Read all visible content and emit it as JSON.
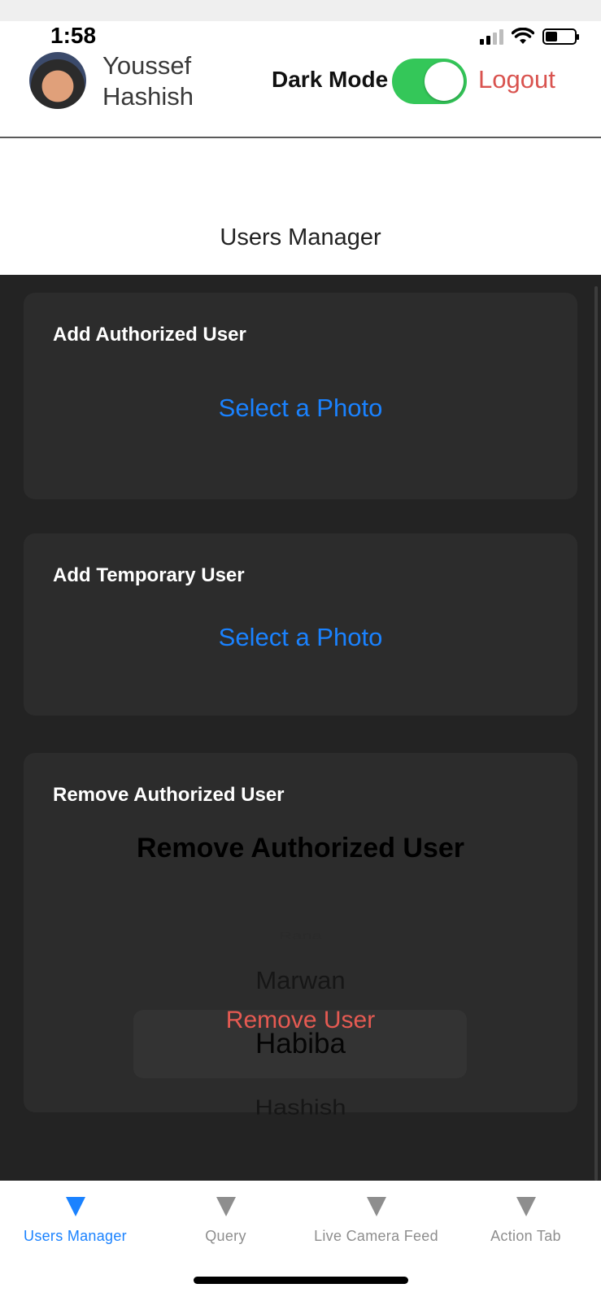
{
  "status": {
    "time": "1:58"
  },
  "header": {
    "user_first": "Youssef",
    "user_last": "Hashish",
    "dark_mode_label": "Dark Mode",
    "dark_mode_on": true,
    "logout_label": "Logout"
  },
  "page": {
    "title": "Users Manager"
  },
  "cards": {
    "add_authorized": {
      "title": "Add Authorized User",
      "action": "Select a Photo"
    },
    "add_temporary": {
      "title": "Add Temporary User",
      "action": "Select a Photo"
    },
    "remove_authorized": {
      "title": "Remove Authorized User",
      "picker_title": "Remove Authorized User",
      "picker_items": [
        "Rana",
        "Marwan",
        "Habiba",
        "Hashish"
      ],
      "selected": "Habiba",
      "remove_label": "Remove User"
    }
  },
  "tabs": [
    {
      "label": "Users Manager",
      "active": true
    },
    {
      "label": "Query",
      "active": false
    },
    {
      "label": "Live Camera Feed",
      "active": false
    },
    {
      "label": "Action Tab",
      "active": false
    }
  ],
  "colors": {
    "accent": "#1a82ff",
    "danger": "#e55a52",
    "toggle_on": "#34c759",
    "card_bg": "#2c2c2c"
  }
}
